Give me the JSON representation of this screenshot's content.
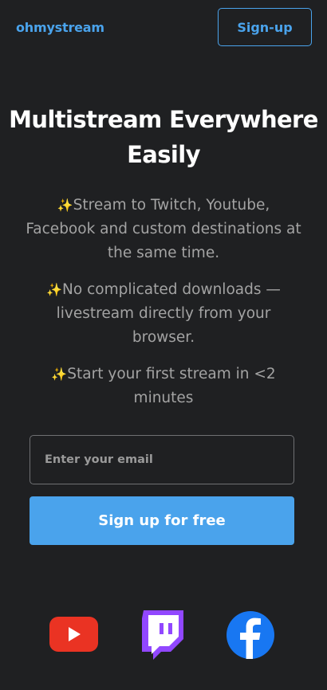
{
  "header": {
    "logo_text": "ohmystream",
    "signup_label": "Sign-up"
  },
  "hero": {
    "title_line1": "Multistream Everywhere",
    "title_line2": "Easily"
  },
  "features": [
    {
      "icon": "sparkles-icon",
      "text": "Stream to Twitch, Youtube, Facebook and custom destinations at the same time."
    },
    {
      "icon": "sparkles-icon",
      "text": "No complicated downloads — livestream directly from your browser."
    },
    {
      "icon": "sparkles-icon",
      "text": "Start your first stream in <2 minutes"
    }
  ],
  "form": {
    "email_placeholder": "Enter your email",
    "email_value": "",
    "cta_label": "Sign up for free"
  },
  "platforms": [
    {
      "name": "youtube-logo",
      "color": "#ea3323"
    },
    {
      "name": "twitch-logo",
      "color": "#9147ff"
    },
    {
      "name": "facebook-logo",
      "color": "#1877f2"
    }
  ],
  "colors": {
    "background": "#1f2022",
    "accent": "#4aa3ec",
    "muted_text": "#a3a3a3",
    "title_text": "#ffffff"
  }
}
